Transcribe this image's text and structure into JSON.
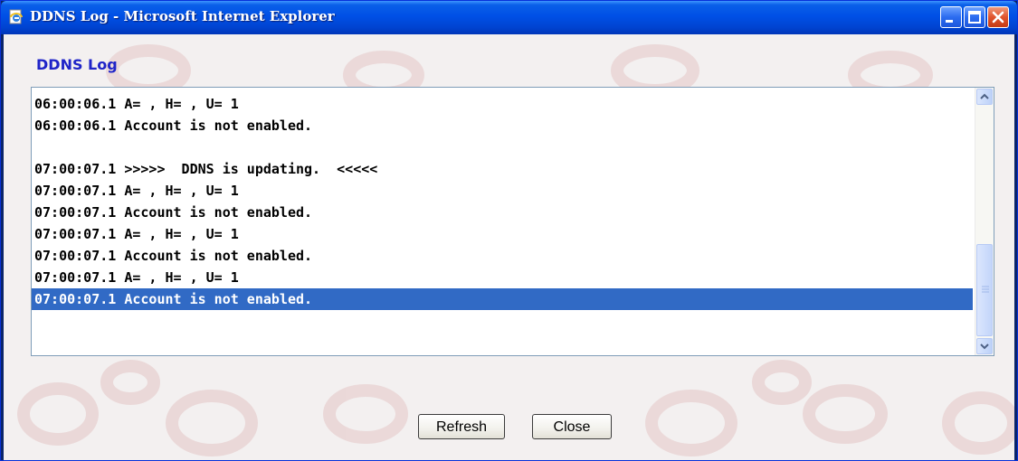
{
  "window": {
    "title": "DDNS Log - Microsoft Internet Explorer"
  },
  "icons": {
    "app": "ie-page-icon",
    "minimize": "minimize-icon",
    "maximize": "maximize-icon",
    "close": "close-icon",
    "scroll_up": "chevron-up-icon",
    "scroll_down": "chevron-down-icon"
  },
  "page": {
    "heading": "DDNS Log"
  },
  "log": {
    "lines": [
      {
        "text": "06:00:06.1 A= , H= , U= 1",
        "selected": false
      },
      {
        "text": "06:00:06.1 Account is not enabled.",
        "selected": false
      },
      {
        "text": "",
        "selected": false
      },
      {
        "text": "07:00:07.1 >>>>>  DDNS is updating.  <<<<<",
        "selected": false
      },
      {
        "text": "07:00:07.1 A= , H= , U= 1",
        "selected": false
      },
      {
        "text": "07:00:07.1 Account is not enabled.",
        "selected": false
      },
      {
        "text": "07:00:07.1 A= , H= , U= 1",
        "selected": false
      },
      {
        "text": "07:00:07.1 Account is not enabled.",
        "selected": false
      },
      {
        "text": "07:00:07.1 A= , H= , U= 1",
        "selected": false
      },
      {
        "text": "07:00:07.1 Account is not enabled.",
        "selected": true
      }
    ]
  },
  "buttons": {
    "refresh": "Refresh",
    "close": "Close"
  },
  "colors": {
    "title_bar": "#0050e6",
    "heading": "#1f24c8",
    "selection": "#316ac5",
    "background": "#f3f0f0"
  }
}
